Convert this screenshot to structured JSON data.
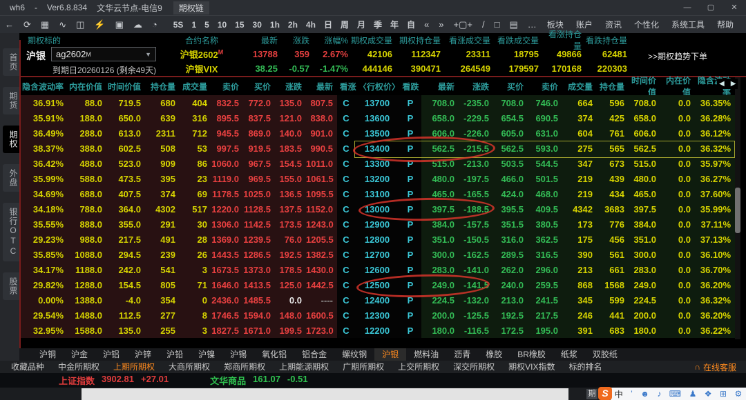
{
  "window": {
    "app": "wh6",
    "sep": "-",
    "version": "Ver6.8.834",
    "node": "文华云节点-电信9",
    "page": "期权链",
    "min": "—",
    "max": "▢",
    "close": "✕"
  },
  "toolbar": {
    "periods": [
      "5S",
      "1",
      "5",
      "10",
      "15",
      "30",
      "1h",
      "2h",
      "4h",
      "日",
      "周",
      "月",
      "季",
      "年",
      "自"
    ],
    "menus": [
      "板块",
      "账户",
      "资讯",
      "个性化",
      "系统工具",
      "帮助"
    ]
  },
  "sidebar": {
    "items": [
      {
        "label": "首页",
        "active": false
      },
      {
        "label": "期货",
        "active": false
      },
      {
        "label": "期权",
        "active": true
      },
      {
        "label": "外盘",
        "active": false
      },
      {
        "label": "银行OTC",
        "active": false
      },
      {
        "label": "股票",
        "active": false
      }
    ]
  },
  "underlying_panel": {
    "label": "期权标的",
    "product": "沪银",
    "contract_select": "ag2602",
    "contract_select_sup": "M",
    "expiry": "到期日20260126 (剩余49天)",
    "columns": [
      "合约名称",
      "最新",
      "涨跌",
      "涨幅%",
      "期权成交量",
      "期权持仓量",
      "看涨成交量",
      "看跌成交量",
      "看涨持仓量",
      "看跌持仓量"
    ],
    "rows": [
      {
        "name": "沪银2602",
        "sup": "M",
        "last": "13788",
        "chg": "359",
        "pct": "2.67%",
        "trend": "up",
        "vols": [
          "42106",
          "112347",
          "23311",
          "18795",
          "49866",
          "62481"
        ]
      },
      {
        "name": "沪银VIX",
        "sup": "",
        "last": "38.25",
        "chg": "-0.57",
        "pct": "-1.47%",
        "trend": "down",
        "vols": [
          "444146",
          "390471",
          "264549",
          "179597",
          "170168",
          "220303"
        ]
      }
    ],
    "order_link": ">>期权趋势下单"
  },
  "chain": {
    "left_headers": [
      "隐含波动率",
      "内在价值",
      "时间价值",
      "持仓量",
      "成交量",
      "卖价",
      "买价",
      "涨跌",
      "最新"
    ],
    "mid_header": "看涨 〈行权价〉 看跌",
    "right_headers": [
      "最新",
      "涨跌",
      "买价",
      "卖价",
      "成交量",
      "持仓量",
      "时间价值",
      "内在价值",
      "隐含波动率"
    ],
    "call_label": "C",
    "put_label": "P",
    "rows": [
      {
        "strike": "13700",
        "call": [
          "36.91%",
          "88.0",
          "719.5",
          "680",
          "404",
          "832.5",
          "772.0",
          "135.0",
          "807.5"
        ],
        "put": [
          "708.0",
          "-235.0",
          "708.0",
          "746.0",
          "664",
          "596",
          "708.0",
          "0.0",
          "36.35%"
        ]
      },
      {
        "strike": "13600",
        "call": [
          "35.91%",
          "188.0",
          "650.0",
          "639",
          "316",
          "895.5",
          "837.5",
          "121.0",
          "838.0"
        ],
        "put": [
          "658.0",
          "-229.5",
          "654.5",
          "690.5",
          "374",
          "425",
          "658.0",
          "0.0",
          "36.28%"
        ]
      },
      {
        "strike": "13500",
        "call": [
          "36.49%",
          "288.0",
          "613.0",
          "2311",
          "712",
          "945.5",
          "869.0",
          "140.0",
          "901.0"
        ],
        "put": [
          "606.0",
          "-226.0",
          "605.0",
          "631.0",
          "604",
          "761",
          "606.0",
          "0.0",
          "36.12%"
        ]
      },
      {
        "strike": "13400",
        "call": [
          "38.37%",
          "388.0",
          "602.5",
          "508",
          "53",
          "997.5",
          "919.5",
          "183.5",
          "990.5"
        ],
        "put": [
          "562.5",
          "-215.5",
          "562.5",
          "593.0",
          "275",
          "565",
          "562.5",
          "0.0",
          "36.32%"
        ],
        "highlight": true
      },
      {
        "strike": "13300",
        "call": [
          "36.42%",
          "488.0",
          "523.0",
          "909",
          "86",
          "1060.0",
          "967.5",
          "154.5",
          "1011.0"
        ],
        "put": [
          "515.0",
          "-213.0",
          "503.5",
          "544.5",
          "347",
          "673",
          "515.0",
          "0.0",
          "35.97%"
        ]
      },
      {
        "strike": "13200",
        "call": [
          "35.99%",
          "588.0",
          "473.5",
          "395",
          "23",
          "1119.0",
          "969.5",
          "155.0",
          "1061.5"
        ],
        "put": [
          "480.0",
          "-197.5",
          "466.0",
          "501.5",
          "219",
          "439",
          "480.0",
          "0.0",
          "36.27%"
        ]
      },
      {
        "strike": "13100",
        "call": [
          "34.69%",
          "688.0",
          "407.5",
          "374",
          "69",
          "1178.5",
          "1025.0",
          "136.5",
          "1095.5"
        ],
        "put": [
          "465.0",
          "-165.5",
          "424.0",
          "468.0",
          "219",
          "434",
          "465.0",
          "0.0",
          "37.60%"
        ]
      },
      {
        "strike": "13000",
        "call": [
          "34.18%",
          "788.0",
          "364.0",
          "4302",
          "517",
          "1220.0",
          "1128.5",
          "137.5",
          "1152.0"
        ],
        "put": [
          "397.5",
          "-188.5",
          "395.5",
          "409.5",
          "4342",
          "3683",
          "397.5",
          "0.0",
          "35.99%"
        ]
      },
      {
        "strike": "12900",
        "call": [
          "35.55%",
          "888.0",
          "355.0",
          "291",
          "30",
          "1306.0",
          "1142.5",
          "173.5",
          "1243.0"
        ],
        "put": [
          "384.0",
          "-157.5",
          "351.5",
          "380.5",
          "173",
          "776",
          "384.0",
          "0.0",
          "37.11%"
        ]
      },
      {
        "strike": "12800",
        "call": [
          "29.23%",
          "988.0",
          "217.5",
          "491",
          "28",
          "1369.0",
          "1239.5",
          "76.0",
          "1205.5"
        ],
        "put": [
          "351.0",
          "-150.5",
          "316.0",
          "362.5",
          "175",
          "456",
          "351.0",
          "0.0",
          "37.13%"
        ]
      },
      {
        "strike": "12700",
        "call": [
          "35.85%",
          "1088.0",
          "294.5",
          "239",
          "26",
          "1443.5",
          "1286.5",
          "192.5",
          "1382.5"
        ],
        "put": [
          "300.0",
          "-162.5",
          "289.5",
          "316.5",
          "390",
          "561",
          "300.0",
          "0.0",
          "36.10%"
        ]
      },
      {
        "strike": "12600",
        "call": [
          "34.17%",
          "1188.0",
          "242.0",
          "541",
          "3",
          "1673.5",
          "1373.0",
          "178.5",
          "1430.0"
        ],
        "put": [
          "283.0",
          "-141.0",
          "262.0",
          "296.0",
          "213",
          "661",
          "283.0",
          "0.0",
          "36.70%"
        ]
      },
      {
        "strike": "12500",
        "call": [
          "29.82%",
          "1288.0",
          "154.5",
          "805",
          "71",
          "1646.0",
          "1413.5",
          "125.0",
          "1442.5"
        ],
        "put": [
          "249.0",
          "-141.5",
          "240.0",
          "259.5",
          "868",
          "1568",
          "249.0",
          "0.0",
          "36.20%"
        ]
      },
      {
        "strike": "12400",
        "call": [
          "0.00%",
          "1388.0",
          "-4.0",
          "354",
          "0",
          "2436.0",
          "1485.5",
          "0.0",
          "----"
        ],
        "call_overrides": {
          "7": "wh",
          "8": "gy"
        },
        "put": [
          "224.5",
          "-132.0",
          "213.0",
          "241.5",
          "345",
          "599",
          "224.5",
          "0.0",
          "36.32%"
        ]
      },
      {
        "strike": "12300",
        "call": [
          "29.54%",
          "1488.0",
          "112.5",
          "277",
          "8",
          "1746.5",
          "1594.0",
          "148.0",
          "1600.5"
        ],
        "put": [
          "200.0",
          "-125.5",
          "192.5",
          "217.5",
          "246",
          "441",
          "200.0",
          "0.0",
          "36.20%"
        ]
      },
      {
        "strike": "12200",
        "call": [
          "32.95%",
          "1588.0",
          "135.0",
          "255",
          "3",
          "1827.5",
          "1671.0",
          "199.5",
          "1723.0"
        ],
        "put": [
          "180.0",
          "-116.5",
          "172.5",
          "195.0",
          "391",
          "683",
          "180.0",
          "0.0",
          "36.22%"
        ]
      }
    ],
    "annotations": {
      "highlight_strike": "13400",
      "circled_strikes": [
        "13400",
        "13000",
        "12500"
      ]
    }
  },
  "product_tabs": {
    "items": [
      "沪铜",
      "沪金",
      "沪铝",
      "沪锌",
      "沪铅",
      "沪镍",
      "沪锡",
      "氧化铝",
      "铝合金",
      "螺纹钢",
      "沪银",
      "燃料油",
      "沥青",
      "橡胶",
      "BR橡胶",
      "纸浆",
      "双胶纸"
    ],
    "active": "沪银"
  },
  "market_tabs": {
    "items": [
      "收藏品种",
      "中金所期权",
      "上期所期权",
      "大商所期权",
      "郑商所期权",
      "上期能源期权",
      "广期所期权",
      "上交所期权",
      "深交所期权",
      "期权VIX指数",
      "标的排名"
    ],
    "active": "上期所期权",
    "service": "在线客服"
  },
  "status_bar": {
    "index_name": "上证指数",
    "index_value": "3902.81",
    "index_chg": "+27.01",
    "wh_name": "文华商品",
    "wh_value": "161.07",
    "wh_chg": "-0.51"
  },
  "taskbar": {
    "ime_candidate": "期",
    "ime_logo": "S",
    "ime_lang": "中",
    "ime_icons": [
      "’",
      "☻",
      "♪",
      "⌨",
      "♟",
      "❖",
      "⊞",
      "⚙"
    ]
  },
  "colors": {
    "up_red": "#e84040",
    "down_green": "#33bb55",
    "yellow": "#d6d300",
    "strike_cyan": "#3bc8d8",
    "header_teal": "#2d9c9c",
    "accent_orange": "#ff8a1e",
    "annotation_red": "#e1372d",
    "highlight_yellow": "#a6a62e"
  }
}
